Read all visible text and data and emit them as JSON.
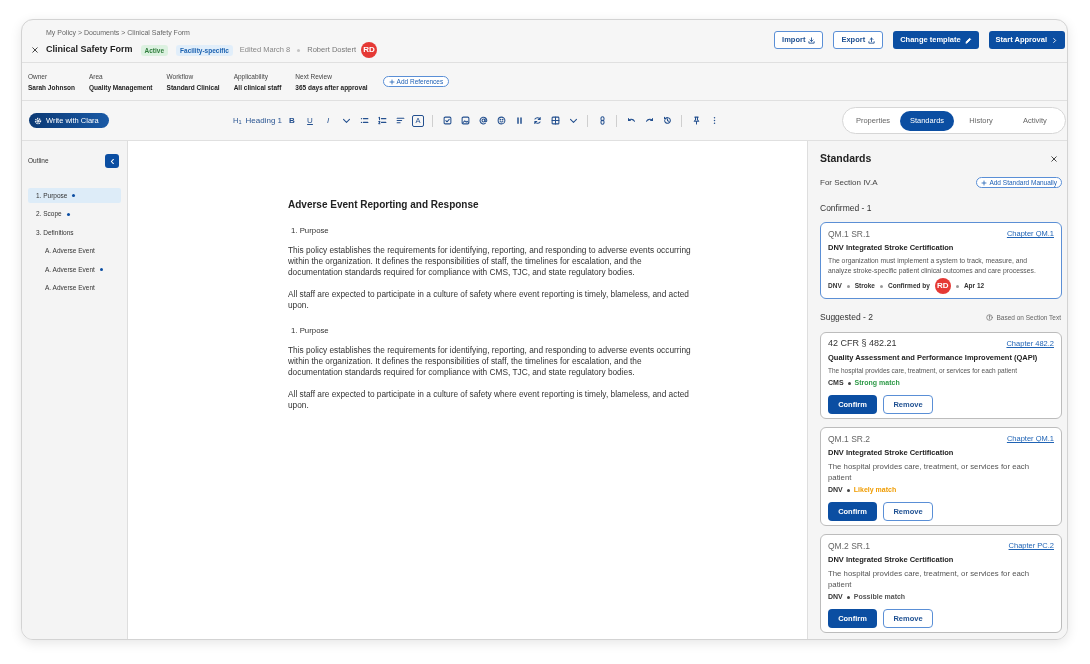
{
  "breadcrumb": "My Policy > Documents > Clinical Safety Form",
  "document_header": {
    "title": "Clinical Safety Form",
    "badges": [
      {
        "label": "Active",
        "kind": "status"
      },
      {
        "label": "Facility-specific",
        "kind": "scope"
      }
    ],
    "edited": "Edited March 8",
    "author": "Robert Dostert",
    "author_avatar": "RD"
  },
  "actions": [
    {
      "label": "Import",
      "kind": "secondary"
    },
    {
      "label": "Export",
      "kind": "secondary"
    },
    {
      "label": "Change template",
      "kind": "primary"
    },
    {
      "label": "Start Approval",
      "kind": "primary"
    }
  ],
  "properties": [
    {
      "label": "Owner",
      "value": "Sarah Johnson"
    },
    {
      "label": "Area",
      "value": "Quality Management"
    },
    {
      "label": "Workflow",
      "value": "Standard Clinical"
    },
    {
      "label": "Applicability",
      "value": "All clinical staff"
    },
    {
      "label": "Next Review",
      "value": "365 days after approval"
    }
  ],
  "add_references": "Add References",
  "editor_toolbar": {
    "assistant_button": "Write with Clara",
    "block_style_glyph": "H$_{1}$",
    "block_style": "Heading 1",
    "format_buttons": [
      "B",
      "U",
      "I"
    ],
    "text_color_button": "A"
  },
  "panel_tabs": [
    {
      "label": "Properties",
      "selected": false
    },
    {
      "label": "Standards",
      "selected": true
    },
    {
      "label": "History",
      "selected": false
    },
    {
      "label": "Activity",
      "selected": false
    }
  ],
  "outline": {
    "title": "Outline",
    "items": [
      {
        "label": "1. Purpose",
        "selected": true,
        "marked": true
      },
      {
        "label": "2. Scope",
        "selected": false,
        "marked": true
      },
      {
        "label": "3. Definitions",
        "selected": false,
        "marked": false,
        "children": [
          {
            "label": "A. Adverse Event",
            "selected": false,
            "marked": false
          },
          {
            "label": "A. Adverse Event",
            "selected": false,
            "marked": true
          },
          {
            "label": "A. Adverse Event",
            "selected": false,
            "marked": false
          }
        ]
      }
    ]
  },
  "document": {
    "title": "Adverse Event Reporting and Response",
    "blocks": [
      {
        "kind": "list_item",
        "text": "1. Purpose"
      },
      {
        "kind": "paragraph",
        "text": "This policy establishes the requirements for identifying, reporting, and responding to adverse events occurring within the organization. It defines the responsibilities of staff, the timelines for escalation, and the documentation standards required for compliance with CMS, TJC, and state regulatory bodies."
      },
      {
        "kind": "paragraph",
        "text": "All staff are expected to participate in a culture of safety where event reporting is timely, blameless, and acted upon."
      },
      {
        "kind": "list_item",
        "text": "1. Purpose"
      },
      {
        "kind": "paragraph",
        "text": "This policy establishes the requirements for identifying, reporting, and responding to adverse events occurring within the organization. It defines the responsibilities of staff, the timelines for escalation, and the documentation standards required for compliance with CMS, TJC, and state regulatory bodies."
      },
      {
        "kind": "paragraph",
        "text": "All staff are expected to participate in a culture of safety where event reporting is timely, blameless, and acted upon."
      }
    ]
  },
  "standards_panel": {
    "title": "Standards",
    "section_label": "For Section IV.A",
    "add_button": "Add Standard Manually",
    "confirmed": {
      "heading": "Confirmed - 1",
      "cards": [
        {
          "code": "QM.1 SR.1",
          "chapter": "Chapter QM.1",
          "title": "DNV Integrated Stroke Certification",
          "description": "The organization must implement a system to track, measure, and analyze stroke-specific patient clinical outcomes and care processes.",
          "source": "DNV",
          "category": "Stroke",
          "confirmed_by": "Confirmed by",
          "confirmer_avatar": "RD",
          "date": "Apr 12"
        }
      ]
    },
    "suggested": {
      "heading": "Suggested - 2",
      "note": "Based on Section Text",
      "cards": [
        {
          "kind": "regulation",
          "code": "42 CFR § 482.21",
          "chapter": "Chapter 482.2",
          "title": "Quality Assessment and Performance Improvement (QAPI)",
          "description": "The hospital provides care, treatment, or services for each patient",
          "source": "CMS",
          "match": {
            "label": "Strong match",
            "color": "#2e9a48"
          },
          "confirm_button": "Confirm",
          "remove_button": "Remove"
        },
        {
          "kind": "standard",
          "code": "QM.1 SR.2",
          "chapter": "Chapter QM.1",
          "title": "DNV Integrated Stroke Certification",
          "description": "The hospital provides care, treatment, or services for each patient",
          "source": "DNV",
          "match": {
            "label": "Likely match",
            "color": "#f09c00"
          },
          "confirm_button": "Confirm",
          "remove_button": "Remove"
        },
        {
          "kind": "standard",
          "code": "QM.2 SR.1",
          "chapter": "Chapter PC.2",
          "title": "DNV Integrated Stroke Certification",
          "description": "The hospital provides care, treatment, or services for each patient",
          "source": "DNV",
          "match": {
            "label": "Possible match",
            "color": "#555555"
          },
          "confirm_button": "Confirm",
          "remove_button": "Remove"
        }
      ]
    }
  }
}
